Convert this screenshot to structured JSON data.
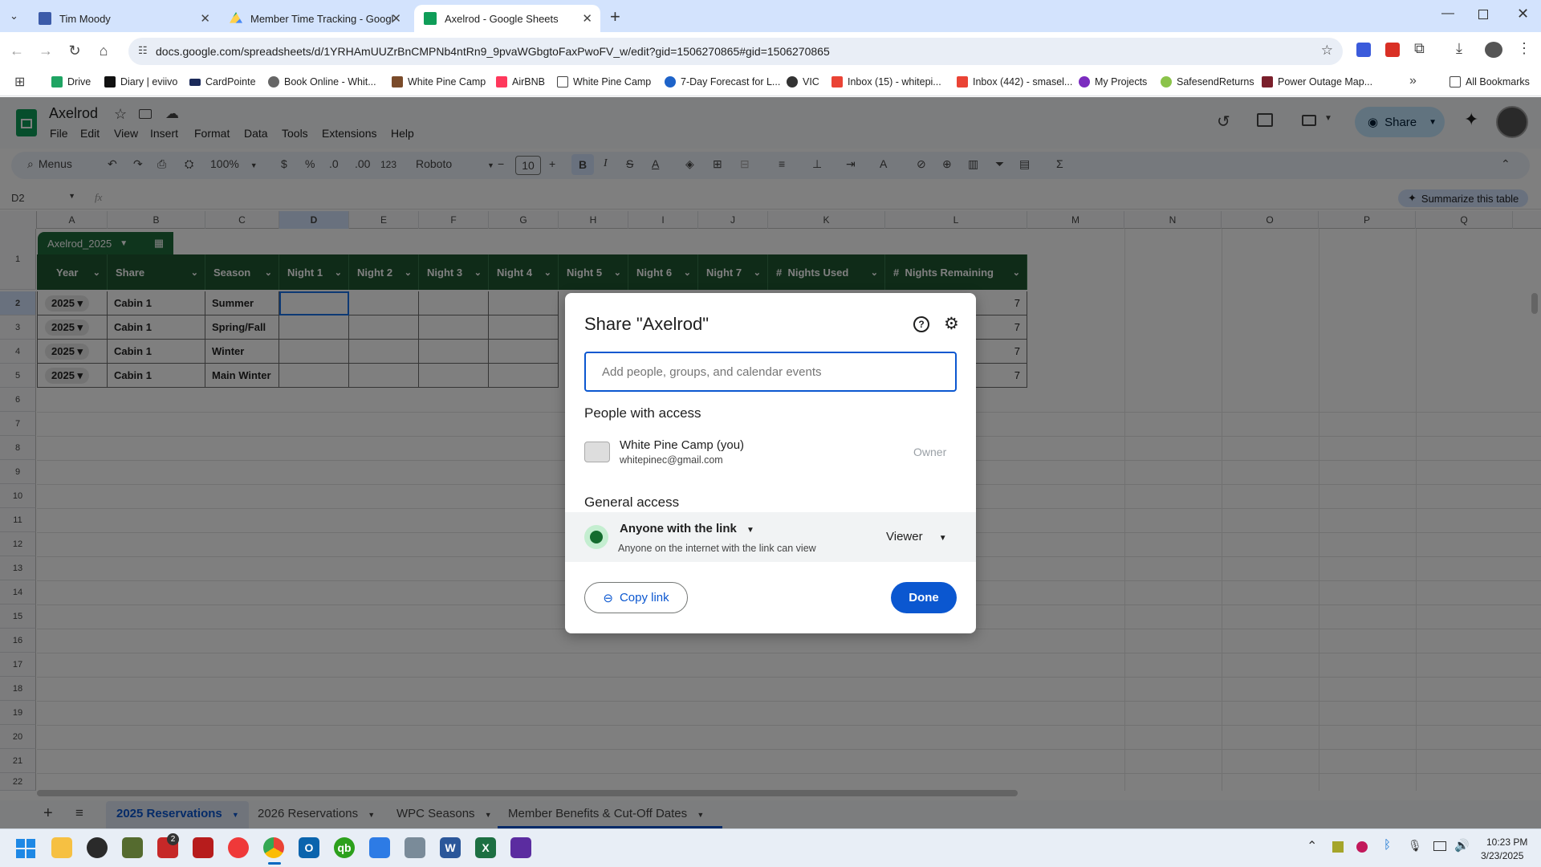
{
  "browser": {
    "tabs": [
      {
        "title": "Tim Moody"
      },
      {
        "title": "Member Time Tracking - Googl"
      },
      {
        "title": "Axelrod - Google Sheets"
      }
    ],
    "url": "docs.google.com/spreadsheets/d/1YRHAmUUZrBnCMPNb4ntRn9_9pvaWGbgtoFaxPwoFV_w/edit?gid=1506270865#gid=1506270865",
    "bookmarks": [
      "Drive",
      "Diary | eviivo",
      "CardPointe",
      "Book Online - Whit...",
      "White Pine Camp",
      "AirBNB",
      "White Pine Camp",
      "7-Day Forecast for L...",
      "VIC",
      "Inbox (15) - whitepi...",
      "Inbox (442) - smasel...",
      "My Projects",
      "SafesendReturns",
      "Power Outage Map..."
    ],
    "all_bookmarks": "All Bookmarks"
  },
  "sheets": {
    "title": "Axelrod",
    "menus": [
      "File",
      "Edit",
      "View",
      "Insert",
      "Format",
      "Data",
      "Tools",
      "Extensions",
      "Help"
    ],
    "share_label": "Share",
    "toolbar": {
      "search": "Menus",
      "zoom": "100%",
      "currency": "$",
      "percent": "%",
      "dec_less": ".0",
      "dec_more": ".00",
      "number_format": "123",
      "font": "Roboto",
      "font_size": "10"
    },
    "name_box": "D2",
    "fx": "fx",
    "summarize": "Summarize this table",
    "columns": [
      "A",
      "B",
      "C",
      "D",
      "E",
      "F",
      "G",
      "H",
      "I",
      "J",
      "K",
      "L",
      "M",
      "N",
      "O",
      "P",
      "Q"
    ],
    "rows": [
      "1",
      "2",
      "3",
      "4",
      "5",
      "6",
      "7",
      "8",
      "9",
      "10",
      "11",
      "12",
      "13",
      "14",
      "15",
      "16",
      "17",
      "18",
      "19",
      "20",
      "21",
      "22"
    ],
    "table_name": "Axelrod_2025",
    "headers": [
      "Year",
      "Share",
      "Season",
      "Night 1",
      "Night 2",
      "Night 3",
      "Night 4",
      "Night 5",
      "Night 6",
      "Night 7",
      "#  Nights Used",
      "#  Nights Remaining"
    ],
    "data_rows": [
      {
        "year": "2025",
        "share": "Cabin 1",
        "season": "Summer",
        "remaining": "7"
      },
      {
        "year": "2025",
        "share": "Cabin 1",
        "season": "Spring/Fall",
        "remaining": "7"
      },
      {
        "year": "2025",
        "share": "Cabin 1",
        "season": "Winter",
        "remaining": "7"
      },
      {
        "year": "2025",
        "share": "Cabin 1",
        "season": "Main Winter",
        "remaining": "7"
      }
    ],
    "sheet_tabs": [
      "2025 Reservations",
      "2026 Reservations",
      "WPC Seasons",
      "Member Benefits & Cut-Off Dates"
    ]
  },
  "dialog": {
    "title": "Share \"Axelrod\"",
    "input_placeholder": "Add people, groups, and calendar events",
    "people_heading": "People with access",
    "person_name": "White Pine Camp (you)",
    "person_email": "whitepinec@gmail.com",
    "person_role": "Owner",
    "general_heading": "General access",
    "access_type": "Anyone with the link",
    "access_desc": "Anyone on the internet with the link can view",
    "access_role": "Viewer",
    "copy_link": "Copy link",
    "done": "Done"
  },
  "taskbar": {
    "time": "10:23 PM",
    "date": "3/23/2025",
    "badge": "2"
  },
  "colors": {
    "accent": "#0b57d0",
    "table_header": "#1e5631",
    "tab_strip": "#d3e3fd"
  }
}
